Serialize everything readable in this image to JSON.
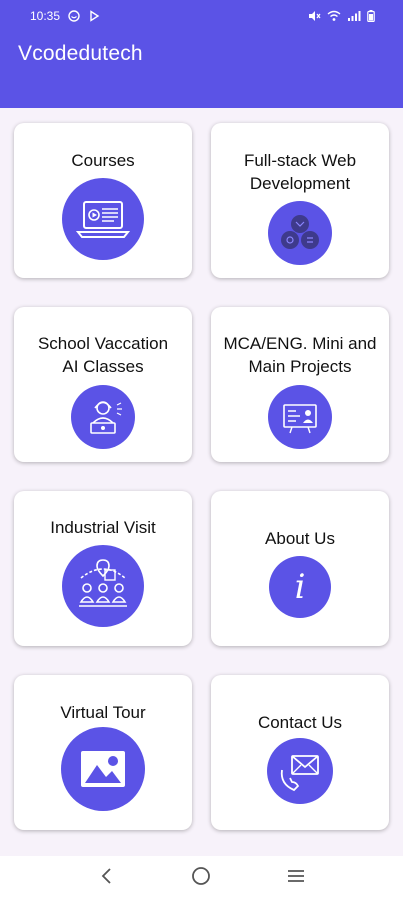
{
  "status_bar": {
    "time": "10:35",
    "icons": [
      "notification-icon",
      "play-icon",
      "mute-icon",
      "wifi-icon",
      "signal-icon",
      "battery-icon"
    ]
  },
  "app_bar": {
    "title": "Vcodedutech"
  },
  "cards": [
    {
      "label": "Courses",
      "icon": "laptop-video-icon"
    },
    {
      "label": "Full-stack Web\nDevelopment",
      "icon": "web-dev-icon"
    },
    {
      "label": "School Vaccation\nAI Classes",
      "icon": "ai-class-icon"
    },
    {
      "label": "MCA/ENG. Mini and\nMain Projects",
      "icon": "project-board-icon"
    },
    {
      "label": "Industrial Visit",
      "icon": "industrial-visit-icon"
    },
    {
      "label": "About Us",
      "icon": "info-icon"
    },
    {
      "label": "Virtual Tour",
      "icon": "image-icon"
    },
    {
      "label": "Contact Us",
      "icon": "mail-phone-icon"
    }
  ],
  "nav_bar": {
    "buttons": [
      "back-icon",
      "home-icon",
      "menu-icon"
    ]
  },
  "colors": {
    "primary": "#5b53e6",
    "background": "#f7f2fa",
    "card": "#ffffff"
  }
}
